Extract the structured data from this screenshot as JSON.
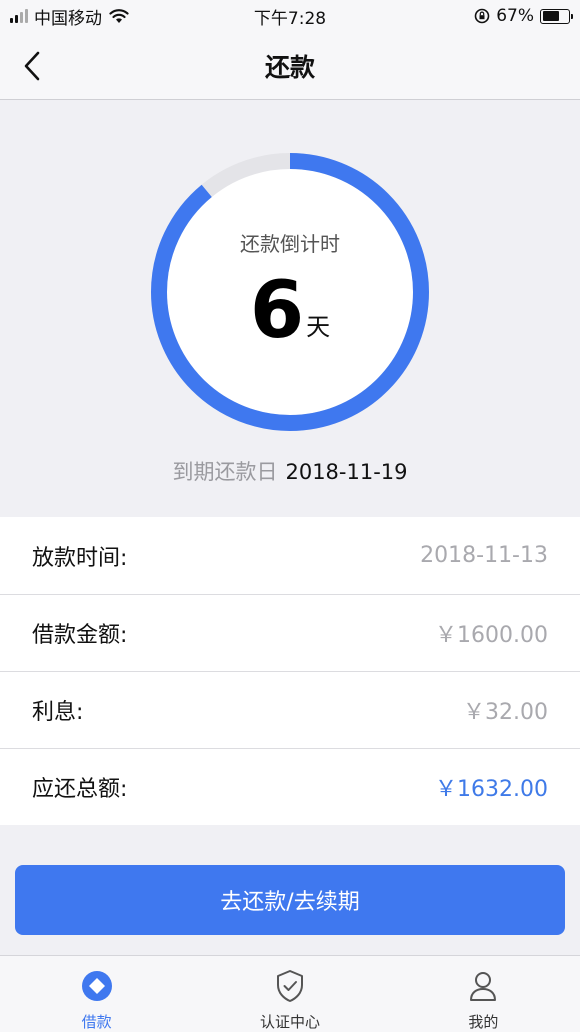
{
  "status_bar": {
    "carrier": "中国移动",
    "time": "下午7:28",
    "battery_text": "67%",
    "battery_level": 0.67
  },
  "nav": {
    "title": "还款"
  },
  "countdown": {
    "label": "还款倒计时",
    "days": "6",
    "unit": "天",
    "progress": 0.89,
    "due_label": "到期还款日",
    "due_date": "2018-11-19"
  },
  "info_rows": [
    {
      "label": "放款时间:",
      "value": "2018-11-13"
    },
    {
      "label": "借款金额:",
      "value": "￥1600.00"
    },
    {
      "label": "利息:",
      "value": "￥32.00"
    },
    {
      "label": "应还总额:",
      "value": "￥1632.00"
    }
  ],
  "action": {
    "label": "去还款/去续期"
  },
  "tabs": [
    {
      "label": "借款",
      "icon": "loan-icon",
      "active": true
    },
    {
      "label": "认证中心",
      "icon": "shield-check-icon",
      "active": false
    },
    {
      "label": "我的",
      "icon": "user-icon",
      "active": false
    }
  ],
  "colors": {
    "accent": "#3f78ef",
    "ring_track": "#e4e4e8",
    "muted_text": "#a9a9ae"
  }
}
